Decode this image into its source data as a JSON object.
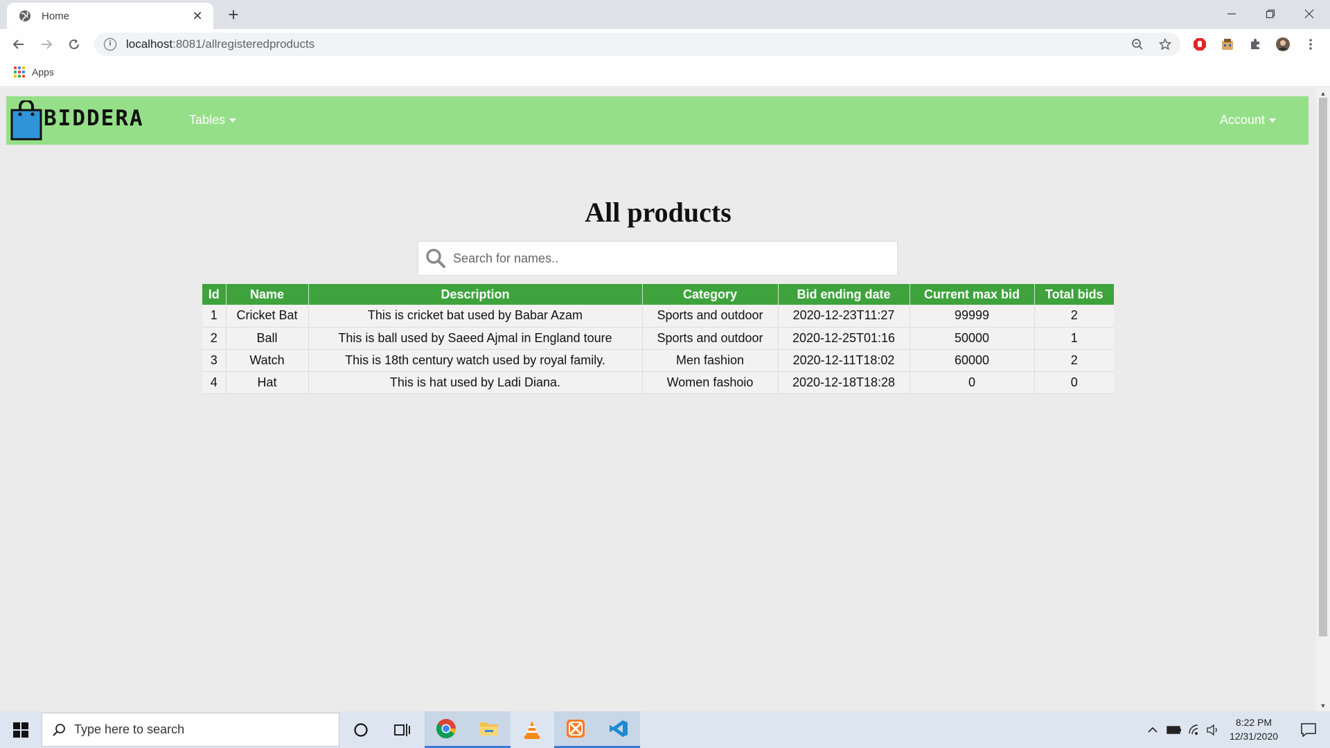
{
  "browser": {
    "tab_title": "Home",
    "tab_close": "✕",
    "new_tab": "+",
    "url_host": "localhost",
    "url_path": ":8081/allregisteredproducts",
    "bookmarks_apps": "Apps",
    "window_controls": {
      "minimize": "—",
      "restore": "❐",
      "close": "✕"
    }
  },
  "navbar": {
    "brand": "BIDDERA",
    "tables_label": "Tables",
    "account_label": "Account"
  },
  "page": {
    "title": "All products",
    "search_placeholder": "Search for names.."
  },
  "table": {
    "headers": [
      "Id",
      "Name",
      "Description",
      "Category",
      "Bid ending date",
      "Current max bid",
      "Total bids"
    ],
    "rows": [
      [
        "1",
        "Cricket Bat",
        "This is cricket bat used by Babar Azam",
        "Sports and outdoor",
        "2020-12-23T11:27",
        "99999",
        "2"
      ],
      [
        "2",
        "Ball",
        "This is ball used by Saeed Ajmal in England toure",
        "Sports and outdoor",
        "2020-12-25T01:16",
        "50000",
        "1"
      ],
      [
        "3",
        "Watch",
        "This is 18th century watch used by royal family.",
        "Men fashion",
        "2020-12-11T18:02",
        "60000",
        "2"
      ],
      [
        "4",
        "Hat",
        "This is hat used by Ladi Diana.",
        "Women fashoio",
        "2020-12-18T18:28",
        "0",
        "0"
      ]
    ]
  },
  "taskbar": {
    "search_placeholder": "Type here to search",
    "time": "8:22 PM",
    "date": "12/31/2020"
  },
  "colors": {
    "navbar_bg": "#96df89",
    "table_header_bg": "#3ea33d",
    "page_bg": "#ebebeb"
  }
}
